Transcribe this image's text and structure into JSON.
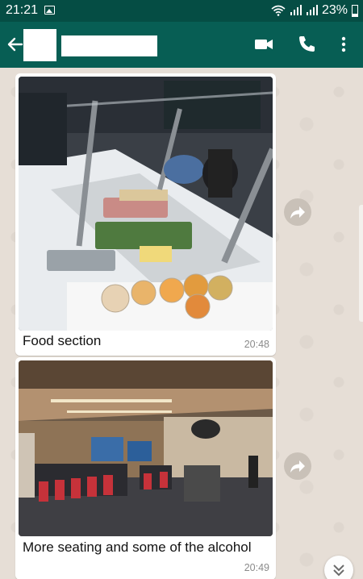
{
  "status_bar": {
    "time": "21:21",
    "battery_percent": "23%",
    "icons": [
      "image-notification-icon",
      "wifi-icon",
      "signal-icon",
      "signal-icon",
      "battery-icon"
    ]
  },
  "app_bar": {
    "icons": [
      "back-arrow-icon",
      "video-call-icon",
      "phone-icon",
      "more-vert-icon"
    ],
    "colors": {
      "bar": "#075e54",
      "status": "#054d44"
    }
  },
  "messages": [
    {
      "caption": "Food section",
      "time": "20:48"
    },
    {
      "caption": "More seating and some of the alcohol",
      "time": "20:49"
    }
  ],
  "colors": {
    "chat_bg": "#e6ded6",
    "bubble": "#ffffff",
    "timestamp": "#8a8a8a"
  }
}
